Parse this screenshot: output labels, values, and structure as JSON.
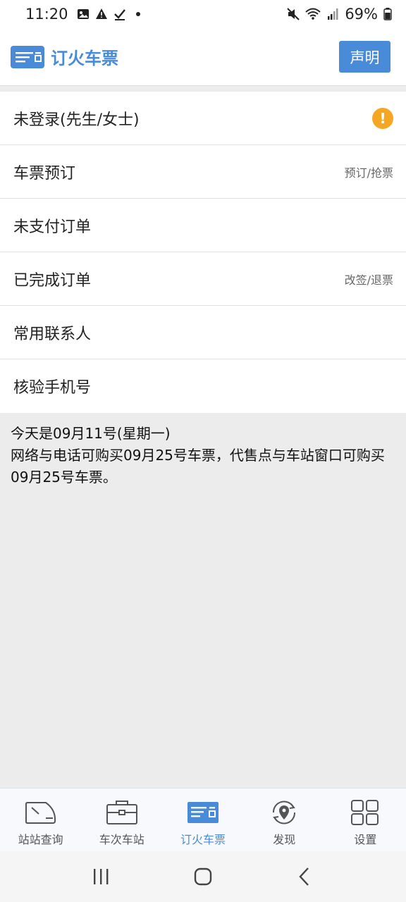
{
  "status": {
    "time": "11:20",
    "battery": "69%"
  },
  "header": {
    "title": "订火车票",
    "declare_label": "声明"
  },
  "menu": [
    {
      "label": "未登录(先生/女士)",
      "hint": ""
    },
    {
      "label": "车票预订",
      "hint": "预订/抢票"
    },
    {
      "label": "未支付订单",
      "hint": ""
    },
    {
      "label": "已完成订单",
      "hint": "改签/退票"
    },
    {
      "label": "常用联系人",
      "hint": ""
    },
    {
      "label": "核验手机号",
      "hint": ""
    }
  ],
  "warning_symbol": "!",
  "info": {
    "line1": "今天是09月11号(星期一)",
    "line2": "网络与电话可购买09月25号车票，代售点与车站窗口可购买09月25号车票。"
  },
  "tabs": [
    {
      "label": "站站查询",
      "icon": "train-icon"
    },
    {
      "label": "车次车站",
      "icon": "briefcase-icon"
    },
    {
      "label": "订火车票",
      "icon": "ticket-icon"
    },
    {
      "label": "发现",
      "icon": "location-refresh-icon"
    },
    {
      "label": "设置",
      "icon": "grid-icon"
    }
  ],
  "colors": {
    "accent": "#4a8bd9",
    "warning": "#f5a623",
    "background": "#ececec"
  }
}
